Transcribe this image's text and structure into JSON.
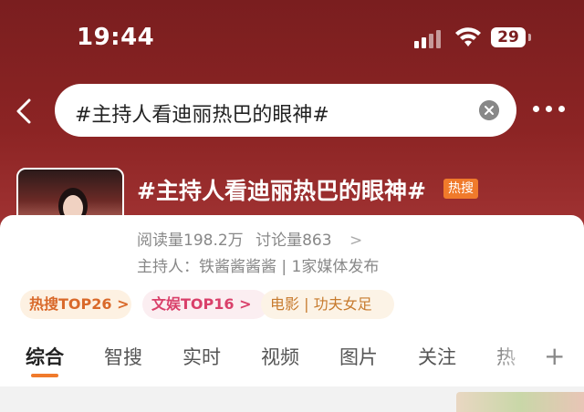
{
  "status_bar": {
    "time": "19:44",
    "battery": "29"
  },
  "search": {
    "query": "#主持人看迪丽热巴的眼神#"
  },
  "topic": {
    "title": "#主持人看迪丽热巴的眼神#",
    "badge": "热搜",
    "reads": "阅读量198.2万",
    "discussions": "讨论量863",
    "stats_arrow": ">",
    "host": "主持人：铁酱酱酱酱 | 1家媒体发布"
  },
  "chips": [
    {
      "label": "热搜TOP26 >"
    },
    {
      "label": "文娱TOP16 >"
    },
    {
      "label": "电影 | 功夫女足"
    }
  ],
  "tabs": [
    {
      "label": "综合"
    },
    {
      "label": "智搜"
    },
    {
      "label": "实时"
    },
    {
      "label": "视频"
    },
    {
      "label": "图片"
    },
    {
      "label": "关注"
    },
    {
      "label": "热"
    }
  ],
  "colors": {
    "header_red": "#8c2424",
    "accent_orange": "#f07a2b"
  }
}
